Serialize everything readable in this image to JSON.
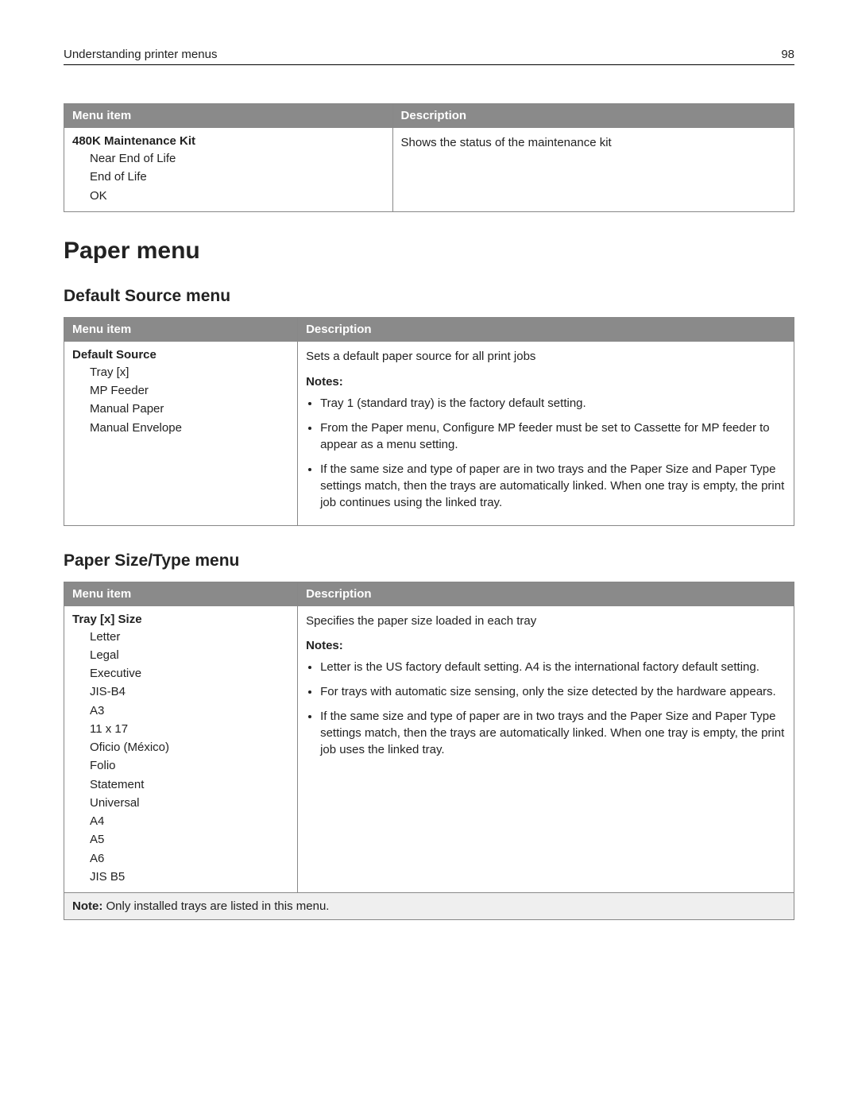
{
  "header": {
    "title": "Understanding printer menus",
    "page_number": "98"
  },
  "table1": {
    "headers": {
      "col1": "Menu item",
      "col2": "Description"
    },
    "row": {
      "item_title": "480K Maintenance Kit",
      "options": [
        "Near End of Life",
        "End of Life",
        "OK"
      ],
      "description": "Shows the status of the maintenance kit"
    }
  },
  "section_heading": "Paper menu",
  "subsection1_heading": "Default Source menu",
  "table2": {
    "headers": {
      "col1": "Menu item",
      "col2": "Description"
    },
    "row": {
      "item_title": "Default Source",
      "options": [
        "Tray [x]",
        "MP Feeder",
        "Manual Paper",
        "Manual Envelope"
      ],
      "description": "Sets a default paper source for all print jobs",
      "notes_label": "Notes:",
      "notes": [
        "Tray 1 (standard tray) is the factory default setting.",
        "From the Paper menu, Configure MP feeder must be set to Cassette for MP feeder to appear as a menu setting.",
        "If the same size and type of paper are in two trays and the Paper Size and Paper Type settings match, then the trays are automatically linked. When one tray is empty, the print job continues using the linked tray."
      ]
    }
  },
  "subsection2_heading": "Paper Size/Type menu",
  "table3": {
    "headers": {
      "col1": "Menu item",
      "col2": "Description"
    },
    "row": {
      "item_title": "Tray [x] Size",
      "options": [
        "Letter",
        "Legal",
        "Executive",
        "JIS-B4",
        "A3",
        "11 x 17",
        "Oficio (México)",
        "Folio",
        "Statement",
        "Universal",
        "A4",
        "A5",
        "A6",
        "JIS B5"
      ],
      "description": "Specifies the paper size loaded in each tray",
      "notes_label": "Notes:",
      "notes": [
        "Letter is the US factory default setting. A4 is the international factory default setting.",
        "For trays with automatic size sensing, only the size detected by the hardware appears.",
        "If the same size and type of paper are in two trays and the Paper Size and Paper Type settings match, then the trays are automatically linked. When one tray is empty, the print job uses the linked tray."
      ]
    },
    "footer_note_label": "Note:",
    "footer_note_text": " Only installed trays are listed in this menu."
  }
}
